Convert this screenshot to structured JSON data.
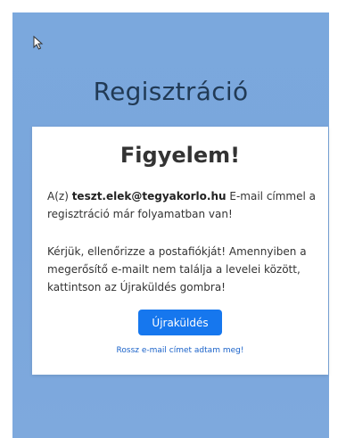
{
  "page": {
    "title": "Regisztráció"
  },
  "notice": {
    "heading": "Figyelem!",
    "line1_prefix": "A(z) ",
    "email": "teszt.elek@tegyakorlo.hu",
    "line1_suffix": " E-mail címmel a regisztráció már folyamatban van!",
    "instructions": "Kérjük, ellenőrizze a postafiókját! Amennyiben a megerősítő e-mailt nem találja a levelei között, kattintson az Újraküldés gombra!",
    "resend_label": "Újraküldés",
    "wrong_email_label": "Rossz e-mail címet adtam meg!"
  },
  "colors": {
    "background": "#7ba8dd",
    "button": "#1677ee",
    "link": "#1a62c9"
  },
  "icons": {
    "cursor": "mouse-pointer-icon"
  }
}
